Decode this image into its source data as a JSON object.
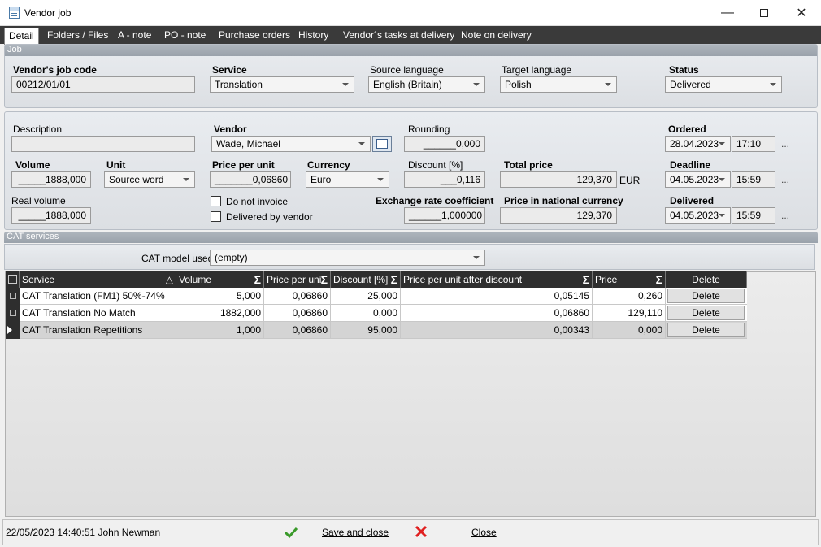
{
  "window": {
    "title": "Vendor job"
  },
  "tabs": [
    "Detail",
    "Folders / Files",
    "A - note",
    "PO - note",
    "Purchase orders",
    "History",
    "Vendor´s tasks at delivery",
    "Note on delivery"
  ],
  "job": {
    "section_label": "Job",
    "vendor_job_code_label": "Vendor's job code",
    "vendor_job_code": "00212/01/01",
    "service_label": "Service",
    "service": "Translation",
    "source_language_label": "Source language",
    "source_language": "English (Britain)",
    "target_language_label": "Target language",
    "target_language": "Polish",
    "status_label": "Status",
    "status": "Delivered"
  },
  "details": {
    "description_label": "Description",
    "description": "",
    "vendor_label": "Vendor",
    "vendor": "Wade, Michael",
    "rounding_label": "Rounding",
    "rounding": "______0,000",
    "ordered_label": "Ordered",
    "ordered_date": "28.04.2023",
    "ordered_time": "17:10",
    "volume_label": "Volume",
    "volume": "_____1888,000",
    "unit_label": "Unit",
    "unit": "Source word",
    "price_per_unit_label": "Price per unit",
    "price_per_unit": "_______0,06860",
    "currency_label": "Currency",
    "currency": "Euro",
    "discount_label": "Discount [%]",
    "discount": "___0,116",
    "total_price_label": "Total price",
    "total_price": "129,370",
    "total_currency": "EUR",
    "deadline_label": "Deadline",
    "deadline_date": "04.05.2023",
    "deadline_time": "15:59",
    "real_volume_label": "Real volume",
    "real_volume": "_____1888,000",
    "do_not_invoice_label": "Do not invoice",
    "delivered_by_vendor_label": "Delivered by vendor",
    "exchange_rate_label": "Exchange rate coefficient",
    "exchange_rate": "______1,000000",
    "price_national_label": "Price in national currency",
    "price_national": "129,370",
    "delivered_label": "Delivered",
    "delivered_date": "04.05.2023",
    "delivered_time": "15:59",
    "dots": "..."
  },
  "cat": {
    "section_label": "CAT services",
    "model_label": "CAT model used:",
    "model": "(empty)",
    "columns": [
      "Service",
      "Volume",
      "Price per uni",
      "Discount [%]",
      "Price per unit after discount",
      "Price",
      "Delete"
    ],
    "rows": [
      {
        "service": "CAT Translation (FM1) 50%-74%",
        "volume": "5,000",
        "price_per_unit": "0,06860",
        "discount": "25,000",
        "price_after": "0,05145",
        "price": "0,260",
        "delete": "Delete"
      },
      {
        "service": "CAT Translation No Match",
        "volume": "1882,000",
        "price_per_unit": "0,06860",
        "discount": "0,000",
        "price_after": "0,06860",
        "price": "129,110",
        "delete": "Delete"
      },
      {
        "service": "CAT Translation Repetitions",
        "volume": "1,000",
        "price_per_unit": "0,06860",
        "discount": "95,000",
        "price_after": "0,00343",
        "price": "0,000",
        "delete": "Delete"
      }
    ]
  },
  "status_bar": {
    "info": "22/05/2023 14:40:51 John Newman",
    "save_close": "Save and close",
    "close": "Close"
  },
  "colors": {
    "tabbar": "#3a3a3a",
    "grid_header": "#2e2e2e",
    "save_icon": "#3a9a2a",
    "cancel_icon": "#e02020"
  }
}
